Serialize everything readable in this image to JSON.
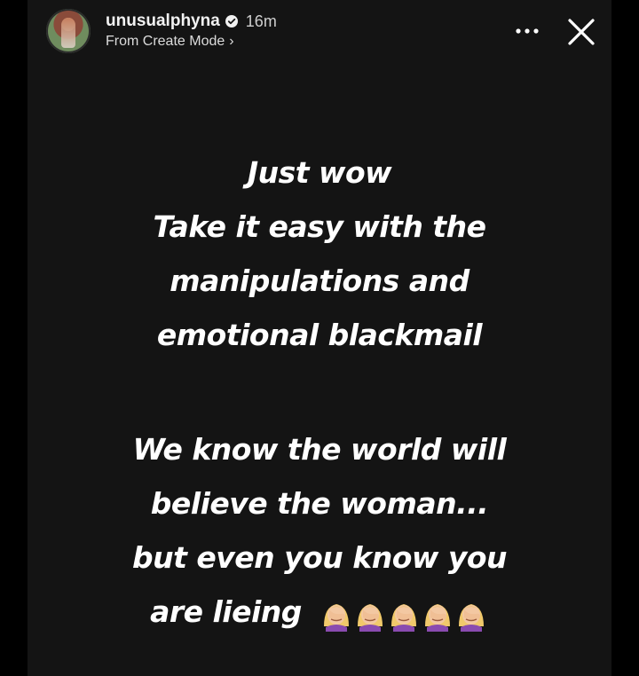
{
  "header": {
    "username": "unusualphyna",
    "time": "16m",
    "subtitle": "From Create Mode",
    "subtitle_chevron": "›",
    "icons": {
      "avatar": "profile-avatar",
      "verified": "verified-badge-icon",
      "more": "more-options-icon",
      "close": "close-icon"
    }
  },
  "story": {
    "paragraph_1": [
      "Just wow",
      "Take it easy with the",
      "manipulations and",
      "emotional blackmail"
    ],
    "paragraph_2": [
      "We know the world will",
      "believe the woman...",
      "but even you know you",
      "are lieing"
    ],
    "emoji_name": "facepalm-icon",
    "emoji_count": 5
  },
  "colors": {
    "background": "#000000",
    "story_background": "#141414",
    "text": "#ffffff",
    "muted_text": "#cfcfcf"
  }
}
